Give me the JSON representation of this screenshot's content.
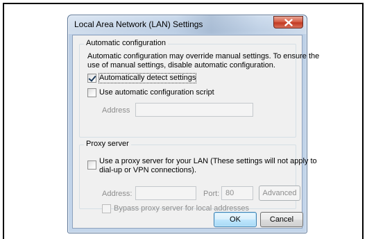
{
  "window": {
    "title": "Local Area Network (LAN) Settings",
    "close_icon": "close-x-icon"
  },
  "automatic": {
    "group_label": "Automatic configuration",
    "description_line1": "Automatic configuration may override manual settings.  To ensure the",
    "description_line2": "use of manual settings, disable automatic configuration.",
    "auto_detect": {
      "label": "Automatically detect settings",
      "checked": true
    },
    "auto_script": {
      "label": "Use automatic configuration script",
      "checked": false
    },
    "address_label": "Address",
    "address_value": ""
  },
  "proxy": {
    "group_label": "Proxy server",
    "use_proxy": {
      "label_line1": "Use a proxy server for your LAN (These settings will not apply to",
      "label_line2": "dial-up or VPN connections).",
      "checked": false
    },
    "address_label": "Address:",
    "address_value": "",
    "port_label": "Port:",
    "port_value": "80",
    "advanced_label": "Advanced",
    "bypass": {
      "label": "Bypass proxy server for local addresses",
      "checked": false
    }
  },
  "buttons": {
    "ok": "OK",
    "cancel": "Cancel"
  }
}
